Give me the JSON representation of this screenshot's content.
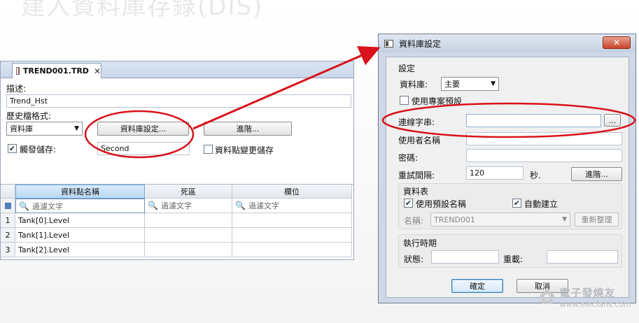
{
  "background_title": "建入資料庫存錄(DIS)",
  "editor": {
    "tab_label": "TREND001.TRD",
    "tab_close": "✕",
    "description_label": "描述:",
    "description_value": "Trend_Hst",
    "history_format_label": "歷史檔格式:",
    "history_format_value": "資料庫",
    "db_settings_button": "資料庫設定...",
    "advanced_button": "進階...",
    "trigger_save_label": "觸發儲存:",
    "trigger_save_checked": true,
    "trigger_save_value": "Second",
    "point_change_save_label": "資料點變更儲存",
    "point_change_save_checked": false,
    "grid": {
      "columns": [
        "資料點名稱",
        "死區",
        "欄位"
      ],
      "filter_placeholder": "過濾文字",
      "rows": [
        {
          "num": "1",
          "name": "Tank[0].Level",
          "deadband": "",
          "field": ""
        },
        {
          "num": "2",
          "name": "Tank[1].Level",
          "deadband": "",
          "field": ""
        },
        {
          "num": "3",
          "name": "Tank[2].Level",
          "deadband": "",
          "field": ""
        }
      ]
    }
  },
  "dialog": {
    "title": "資料庫設定",
    "close_label": "✕",
    "settings_group": "設定",
    "database_label": "資料庫:",
    "database_value": "主要",
    "use_project_default_label": "使用專案預設",
    "use_project_default_checked": false,
    "connection_string_label": "連線字串:",
    "connection_string_value": "",
    "browse_button": "...",
    "username_label": "使用者名稱",
    "username_value": "",
    "password_label": "密碼:",
    "password_value": "",
    "retry_interval_label": "重試間隔:",
    "retry_interval_value": "120",
    "seconds_label": "秒.",
    "advanced_button": "進階...",
    "table_group": "資料表",
    "use_default_name_label": "使用預設名稱",
    "use_default_name_checked": true,
    "auto_create_label": "自動建立",
    "auto_create_checked": true,
    "name_label": "名稱:",
    "name_value": "TREND001",
    "rebuild_button": "重新整理",
    "runtime_group": "執行時期",
    "status_label": "狀態:",
    "status_value": "",
    "reload_label": "重載:",
    "reload_value": "",
    "ok_button": "確定",
    "cancel_button": "取消"
  },
  "watermark": {
    "name": "電子發燒友",
    "url": "www.elecfans.com"
  },
  "colors": {
    "annotation_red": "#d9121b",
    "dialog_frame": "#cfd8e6",
    "selected_header": "#b8d8f5"
  }
}
